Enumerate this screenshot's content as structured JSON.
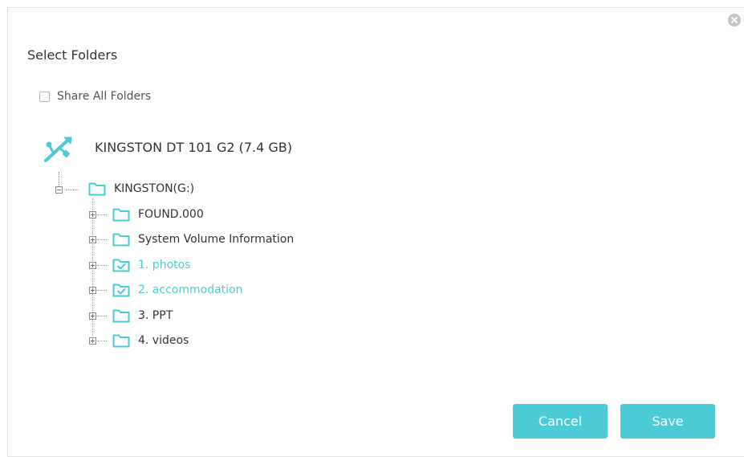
{
  "dialog": {
    "title": "Select Folders",
    "share_all_label": "Share All Folders",
    "share_all_checked": false
  },
  "device": {
    "name": "KINGSTON DT 101 G2 (7.4 GB)",
    "icon": "usb-icon"
  },
  "tree": {
    "root": {
      "label": "KINGSTON(G:)",
      "expanded": true,
      "icon": "folder-icon"
    },
    "children": [
      {
        "label": "FOUND.000",
        "selected": false,
        "icon": "folder-icon"
      },
      {
        "label": "System Volume Information",
        "selected": false,
        "icon": "folder-icon"
      },
      {
        "label": "1. photos",
        "selected": true,
        "icon": "folder-check-icon"
      },
      {
        "label": "2. accommodation",
        "selected": true,
        "icon": "folder-check-icon"
      },
      {
        "label": "3. PPT",
        "selected": false,
        "icon": "folder-icon"
      },
      {
        "label": "4. videos",
        "selected": false,
        "icon": "folder-icon"
      }
    ]
  },
  "buttons": {
    "cancel_label": "Cancel",
    "save_label": "Save"
  },
  "colors": {
    "accent": "#4acbd6",
    "text": "#333333",
    "close_icon": "#c4c4c4"
  }
}
